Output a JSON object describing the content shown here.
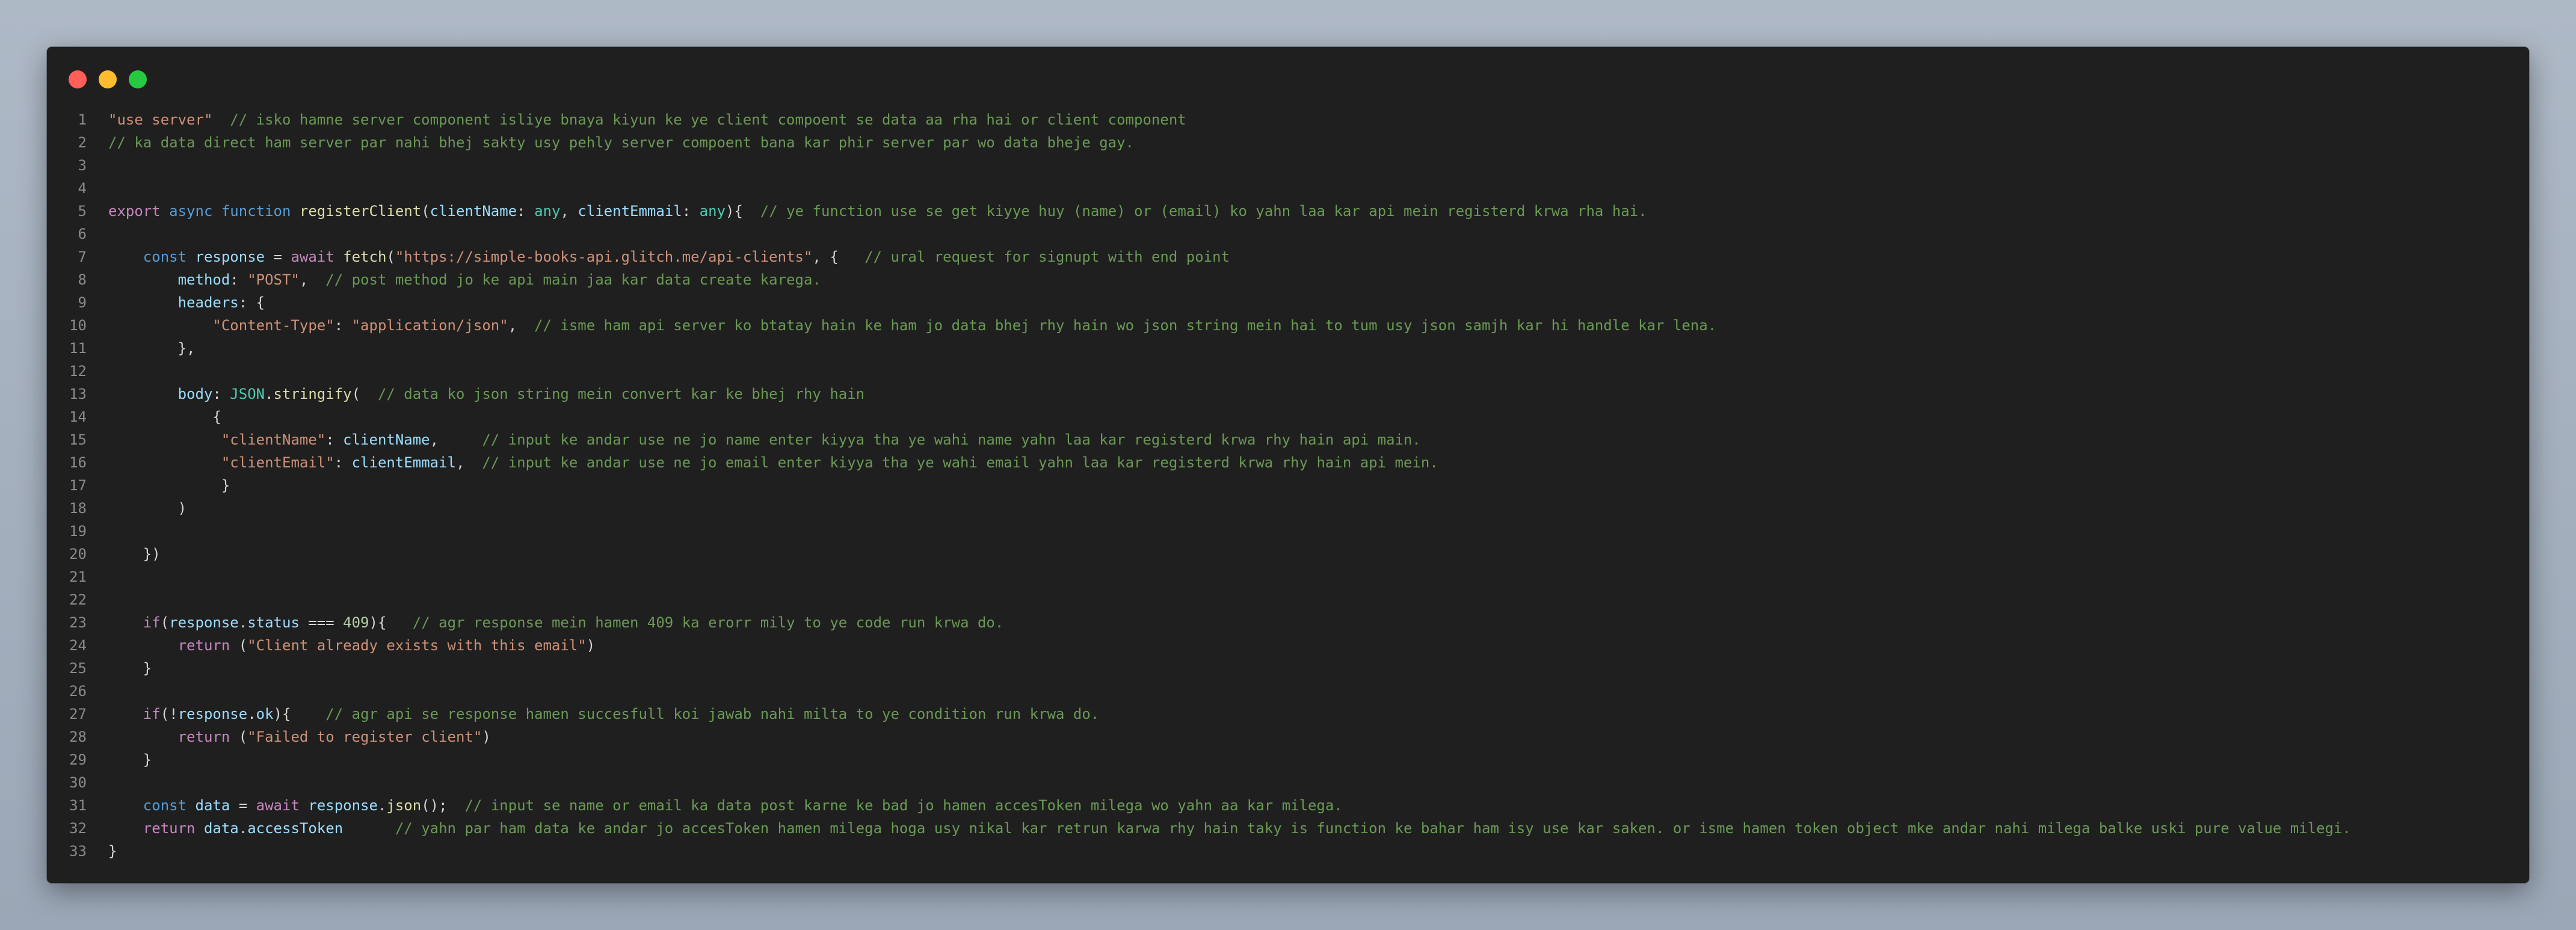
{
  "window": {
    "controls": [
      {
        "name": "close-button",
        "color": "#ff5f57"
      },
      {
        "name": "minimize-button",
        "color": "#febc2e"
      },
      {
        "name": "maximize-button",
        "color": "#28c840"
      }
    ]
  },
  "colors": {
    "t": "#d4d4d4",
    "k": "#569cd6",
    "c": "#c586c0",
    "s": "#ce9178",
    "cm": "#6a9955",
    "f": "#dcdcaa",
    "v": "#9cdcfe",
    "n": "#b5cea8",
    "y": "#4ec9b0",
    "p": "#d4d4d4"
  },
  "editor": {
    "lines": [
      {
        "num": "1",
        "tokens": [
          [
            "s",
            "\"use server\""
          ],
          [
            "t",
            "  "
          ],
          [
            "cm",
            "// isko hamne server component isliye bnaya kiyun ke ye client compoent se data aa rha hai or client component"
          ]
        ]
      },
      {
        "num": "2",
        "tokens": [
          [
            "cm",
            "// ka data direct ham server par nahi bhej sakty usy pehly server compoent bana kar phir server par wo data bheje gay."
          ]
        ]
      },
      {
        "num": "3",
        "tokens": []
      },
      {
        "num": "4",
        "tokens": []
      },
      {
        "num": "5",
        "tokens": [
          [
            "c",
            "export"
          ],
          [
            "t",
            " "
          ],
          [
            "k",
            "async"
          ],
          [
            "t",
            " "
          ],
          [
            "k",
            "function"
          ],
          [
            "t",
            " "
          ],
          [
            "f",
            "registerClient"
          ],
          [
            "p",
            "("
          ],
          [
            "v",
            "clientName"
          ],
          [
            "p",
            ": "
          ],
          [
            "y",
            "any"
          ],
          [
            "p",
            ", "
          ],
          [
            "v",
            "clientEmmail"
          ],
          [
            "p",
            ": "
          ],
          [
            "y",
            "any"
          ],
          [
            "p",
            "){"
          ],
          [
            "t",
            "  "
          ],
          [
            "cm",
            "// ye function use se get kiyye huy (name) or (email) ko yahn laa kar api mein registerd krwa rha hai."
          ]
        ]
      },
      {
        "num": "6",
        "tokens": []
      },
      {
        "num": "7",
        "tokens": [
          [
            "t",
            "    "
          ],
          [
            "k",
            "const"
          ],
          [
            "t",
            " "
          ],
          [
            "v",
            "response"
          ],
          [
            "t",
            " = "
          ],
          [
            "c",
            "await"
          ],
          [
            "t",
            " "
          ],
          [
            "f",
            "fetch"
          ],
          [
            "p",
            "("
          ],
          [
            "s",
            "\"https://simple-books-api.glitch.me/api-clients\""
          ],
          [
            "p",
            ", {"
          ],
          [
            "t",
            "   "
          ],
          [
            "cm",
            "// ural request for signupt with end point"
          ]
        ]
      },
      {
        "num": "8",
        "tokens": [
          [
            "t",
            "        "
          ],
          [
            "v",
            "method"
          ],
          [
            "p",
            ": "
          ],
          [
            "s",
            "\"POST\""
          ],
          [
            "p",
            ","
          ],
          [
            "t",
            "  "
          ],
          [
            "cm",
            "// post method jo ke api main jaa kar data create karega."
          ]
        ]
      },
      {
        "num": "9",
        "tokens": [
          [
            "t",
            "        "
          ],
          [
            "v",
            "headers"
          ],
          [
            "p",
            ": {"
          ]
        ]
      },
      {
        "num": "10",
        "tokens": [
          [
            "t",
            "            "
          ],
          [
            "s",
            "\"Content-Type\""
          ],
          [
            "p",
            ": "
          ],
          [
            "s",
            "\"application/json\""
          ],
          [
            "p",
            ","
          ],
          [
            "t",
            "  "
          ],
          [
            "cm",
            "// isme ham api server ko btatay hain ke ham jo data bhej rhy hain wo json string mein hai to tum usy json samjh kar hi handle kar lena."
          ]
        ]
      },
      {
        "num": "11",
        "tokens": [
          [
            "t",
            "        "
          ],
          [
            "p",
            "},"
          ]
        ]
      },
      {
        "num": "12",
        "tokens": []
      },
      {
        "num": "13",
        "tokens": [
          [
            "t",
            "        "
          ],
          [
            "v",
            "body"
          ],
          [
            "p",
            ": "
          ],
          [
            "y",
            "JSON"
          ],
          [
            "p",
            "."
          ],
          [
            "f",
            "stringify"
          ],
          [
            "p",
            "("
          ],
          [
            "t",
            "  "
          ],
          [
            "cm",
            "// data ko json string mein convert kar ke bhej rhy hain"
          ]
        ]
      },
      {
        "num": "14",
        "tokens": [
          [
            "t",
            "            "
          ],
          [
            "p",
            "{"
          ]
        ]
      },
      {
        "num": "15",
        "tokens": [
          [
            "t",
            "             "
          ],
          [
            "s",
            "\"clientName\""
          ],
          [
            "p",
            ": "
          ],
          [
            "v",
            "clientName"
          ],
          [
            "p",
            ","
          ],
          [
            "t",
            "     "
          ],
          [
            "cm",
            "// input ke andar use ne jo name enter kiyya tha ye wahi name yahn laa kar registerd krwa rhy hain api main."
          ]
        ]
      },
      {
        "num": "16",
        "tokens": [
          [
            "t",
            "             "
          ],
          [
            "s",
            "\"clientEmail\""
          ],
          [
            "p",
            ": "
          ],
          [
            "v",
            "clientEmmail"
          ],
          [
            "p",
            ","
          ],
          [
            "t",
            "  "
          ],
          [
            "cm",
            "// input ke andar use ne jo email enter kiyya tha ye wahi email yahn laa kar registerd krwa rhy hain api mein."
          ]
        ]
      },
      {
        "num": "17",
        "tokens": [
          [
            "t",
            "             "
          ],
          [
            "p",
            "}"
          ]
        ]
      },
      {
        "num": "18",
        "tokens": [
          [
            "t",
            "        "
          ],
          [
            "p",
            ")"
          ]
        ]
      },
      {
        "num": "19",
        "tokens": []
      },
      {
        "num": "20",
        "tokens": [
          [
            "t",
            "    "
          ],
          [
            "p",
            "})"
          ]
        ]
      },
      {
        "num": "21",
        "tokens": []
      },
      {
        "num": "22",
        "tokens": []
      },
      {
        "num": "23",
        "tokens": [
          [
            "t",
            "    "
          ],
          [
            "c",
            "if"
          ],
          [
            "p",
            "("
          ],
          [
            "v",
            "response"
          ],
          [
            "p",
            "."
          ],
          [
            "v",
            "status"
          ],
          [
            "t",
            " === "
          ],
          [
            "n",
            "409"
          ],
          [
            "p",
            "){"
          ],
          [
            "t",
            "   "
          ],
          [
            "cm",
            "// agr response mein hamen 409 ka erorr mily to ye code run krwa do."
          ]
        ]
      },
      {
        "num": "24",
        "tokens": [
          [
            "t",
            "        "
          ],
          [
            "c",
            "return"
          ],
          [
            "t",
            " "
          ],
          [
            "p",
            "("
          ],
          [
            "s",
            "\"Client already exists with this email\""
          ],
          [
            "p",
            ")"
          ]
        ]
      },
      {
        "num": "25",
        "tokens": [
          [
            "t",
            "    "
          ],
          [
            "p",
            "}"
          ]
        ]
      },
      {
        "num": "26",
        "tokens": []
      },
      {
        "num": "27",
        "tokens": [
          [
            "t",
            "    "
          ],
          [
            "c",
            "if"
          ],
          [
            "p",
            "(!"
          ],
          [
            "v",
            "response"
          ],
          [
            "p",
            "."
          ],
          [
            "v",
            "ok"
          ],
          [
            "p",
            "){"
          ],
          [
            "t",
            "    "
          ],
          [
            "cm",
            "// agr api se response hamen succesfull koi jawab nahi milta to ye condition run krwa do."
          ]
        ]
      },
      {
        "num": "28",
        "tokens": [
          [
            "t",
            "        "
          ],
          [
            "c",
            "return"
          ],
          [
            "t",
            " "
          ],
          [
            "p",
            "("
          ],
          [
            "s",
            "\"Failed to register client\""
          ],
          [
            "p",
            ")"
          ]
        ]
      },
      {
        "num": "29",
        "tokens": [
          [
            "t",
            "    "
          ],
          [
            "p",
            "}"
          ]
        ]
      },
      {
        "num": "30",
        "tokens": []
      },
      {
        "num": "31",
        "tokens": [
          [
            "t",
            "    "
          ],
          [
            "k",
            "const"
          ],
          [
            "t",
            " "
          ],
          [
            "v",
            "data"
          ],
          [
            "t",
            " = "
          ],
          [
            "c",
            "await"
          ],
          [
            "t",
            " "
          ],
          [
            "v",
            "response"
          ],
          [
            "p",
            "."
          ],
          [
            "f",
            "json"
          ],
          [
            "p",
            "();"
          ],
          [
            "t",
            "  "
          ],
          [
            "cm",
            "// input se name or email ka data post karne ke bad jo hamen accesToken milega wo yahn aa kar milega."
          ]
        ]
      },
      {
        "num": "32",
        "tokens": [
          [
            "t",
            "    "
          ],
          [
            "c",
            "return"
          ],
          [
            "t",
            " "
          ],
          [
            "v",
            "data"
          ],
          [
            "p",
            "."
          ],
          [
            "v",
            "accessToken"
          ],
          [
            "t",
            "      "
          ],
          [
            "cm",
            "// yahn par ham data ke andar jo accesToken hamen milega hoga usy nikal kar retrun karwa rhy hain taky is function ke bahar ham isy use kar saken. or isme hamen token object mke andar nahi milega balke uski pure value milegi."
          ]
        ]
      },
      {
        "num": "33",
        "tokens": [
          [
            "p",
            "}"
          ]
        ]
      }
    ]
  }
}
